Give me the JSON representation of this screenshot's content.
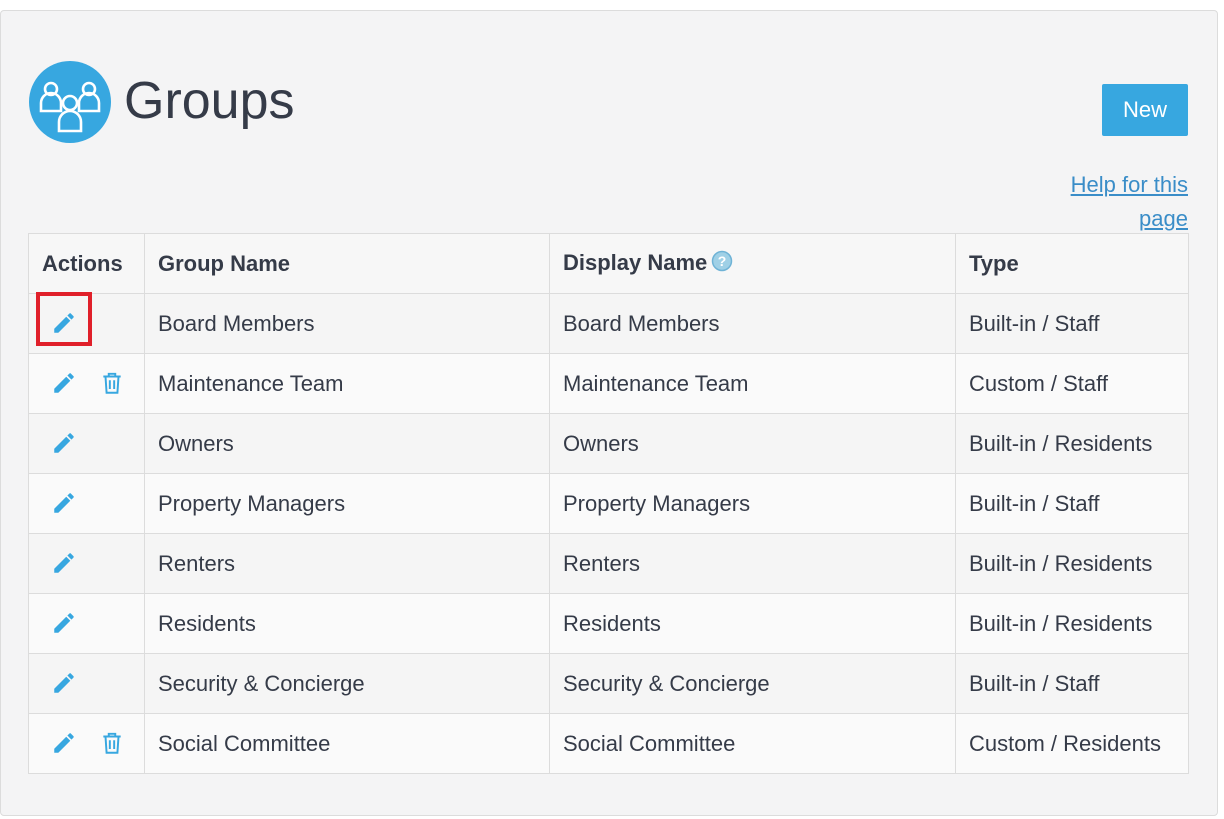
{
  "header": {
    "title": "Groups",
    "new_button_label": "New",
    "help_link_text": "Help for this page"
  },
  "table": {
    "columns": [
      "Actions",
      "Group Name",
      "Display Name",
      "Type"
    ],
    "rows": [
      {
        "group_name": "Board Members",
        "display_name": "Board Members",
        "type": "Built-in / Staff",
        "deletable": false,
        "highlighted_edit": true
      },
      {
        "group_name": "Maintenance Team",
        "display_name": "Maintenance Team",
        "type": "Custom / Staff",
        "deletable": true
      },
      {
        "group_name": "Owners",
        "display_name": "Owners",
        "type": "Built-in / Residents",
        "deletable": false
      },
      {
        "group_name": "Property Managers",
        "display_name": "Property Managers",
        "type": "Built-in / Staff",
        "deletable": false
      },
      {
        "group_name": "Renters",
        "display_name": "Renters",
        "type": "Built-in / Residents",
        "deletable": false
      },
      {
        "group_name": "Residents",
        "display_name": "Residents",
        "type": "Built-in / Residents",
        "deletable": false
      },
      {
        "group_name": "Security & Concierge",
        "display_name": "Security & Concierge",
        "type": "Built-in / Staff",
        "deletable": false
      },
      {
        "group_name": "Social Committee",
        "display_name": "Social Committee",
        "type": "Custom / Residents",
        "deletable": true
      }
    ]
  },
  "icons": {
    "page_icon": "group-icon",
    "edit": "pencil-icon",
    "delete": "trash-icon",
    "help": "question-mark-icon"
  },
  "colors": {
    "accent": "#37a7e0",
    "link": "#3a8dc8",
    "highlight": "#e0202a",
    "text": "#353b48"
  }
}
